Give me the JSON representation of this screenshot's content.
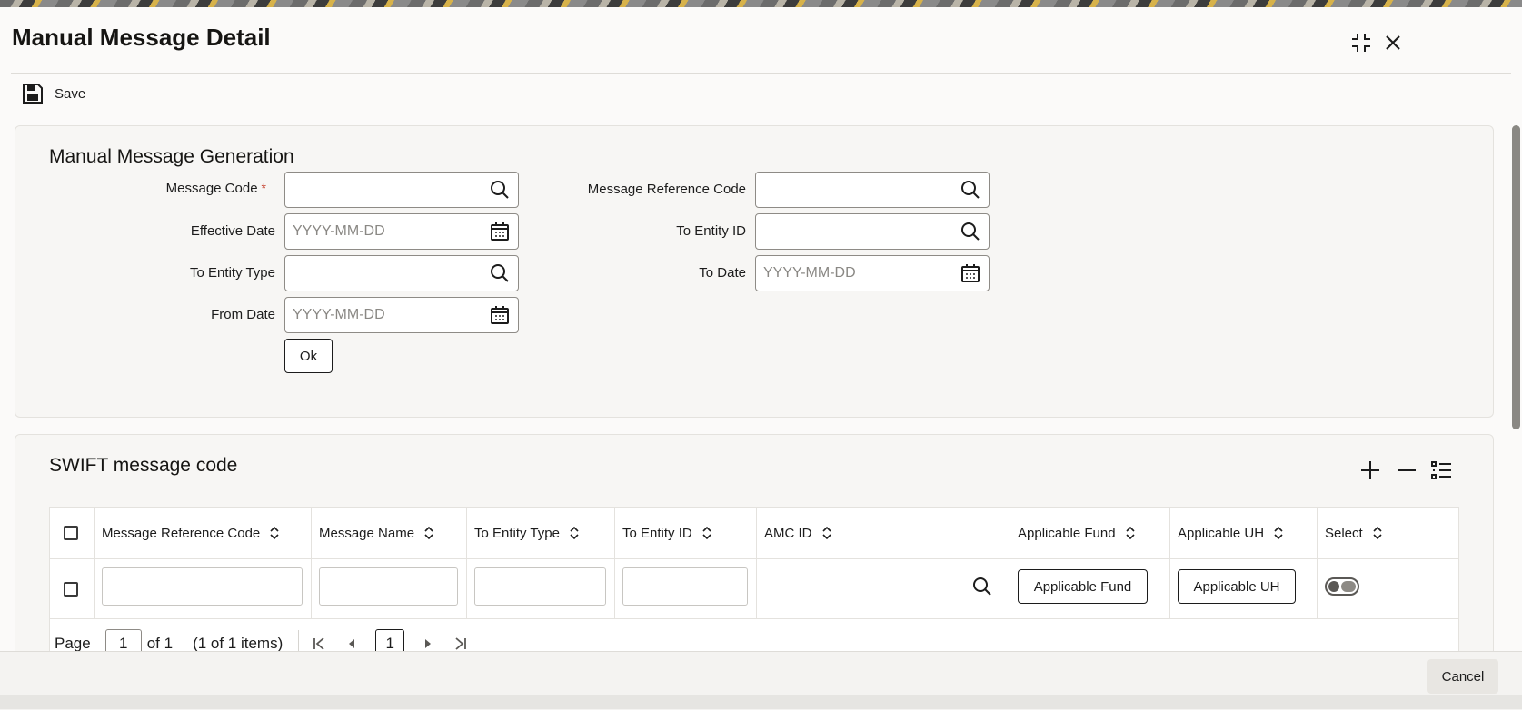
{
  "window": {
    "title": "Manual Message Detail",
    "save_label": "Save",
    "cancel_label": "Cancel"
  },
  "generation": {
    "title": "Manual Message Generation",
    "message_code_label": "Message Code",
    "required_mark": "*",
    "effective_date_label": "Effective Date",
    "to_entity_type_label": "To Entity Type",
    "from_date_label": "From Date",
    "message_reference_code_label": "Message Reference Code",
    "to_entity_id_label": "To Entity ID",
    "to_date_label": "To Date",
    "date_placeholder": "YYYY-MM-DD",
    "ok_label": "Ok"
  },
  "swift": {
    "title": "SWIFT message code",
    "columns": [
      "Message Reference Code",
      "Message Name",
      "To Entity Type",
      "To Entity ID",
      "AMC ID",
      "Applicable Fund",
      "Applicable UH",
      "Select"
    ],
    "row": {
      "applicable_fund_button": "Applicable Fund",
      "applicable_uh_button": "Applicable UH"
    },
    "pagination": {
      "page_label": "Page",
      "current_page": "1",
      "of_label": "of 1",
      "items_label": "(1 of 1 items)"
    }
  },
  "icons": {
    "save": "save-icon",
    "maximize": "maximize-icon",
    "close": "close-icon",
    "search": "search-icon",
    "calendar": "calendar-icon",
    "add": "plus-icon",
    "remove": "minus-icon",
    "columns": "column-list-icon"
  }
}
